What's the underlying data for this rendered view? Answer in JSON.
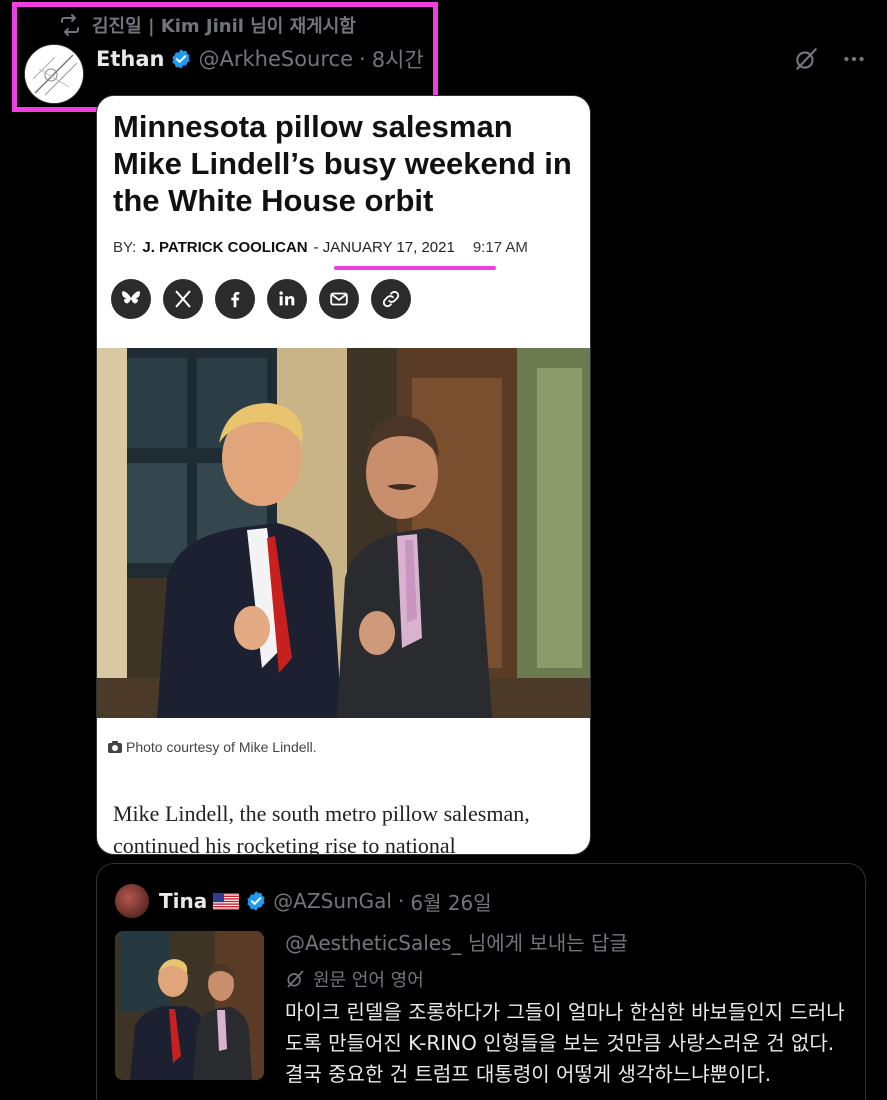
{
  "retweet": {
    "text": "김진일 | Kim Jinil 님이 재게시함"
  },
  "tweet": {
    "author_name": "Ethan",
    "handle": "@ArkheSource",
    "separator": "·",
    "time": "8시간"
  },
  "article": {
    "headline": "Minnesota pillow salesman Mike Lindell’s busy weekend in the White House orbit",
    "byline_prefix": "BY:",
    "byline_author": "J. PATRICK COOLICAN",
    "byline_date": "- JANUARY 17, 2021",
    "byline_time": "9:17 AM",
    "photo_caption": "Photo courtesy of Mike Lindell.",
    "body": "Mike Lindell, the south metro pillow salesman, continued his rocketing rise to national"
  },
  "share_icons": [
    "bluesky-icon",
    "x-icon",
    "facebook-icon",
    "linkedin-icon",
    "email-icon",
    "link-icon"
  ],
  "quote": {
    "author_name": "Tina",
    "handle": "@AZSunGal",
    "separator": "·",
    "time": "6월 26일",
    "reply_to": "@AestheticSales_ 님에게 보내는 답글",
    "translate_label": "원문 언어 영어",
    "text": "마이크 린델을 조롱하다가 그들이 얼마나 한심한 바보들인지 드러나도록 만들어진 K-RINO 인형들을 보는 것만큼 사랑스러운 건 없다. 결국 중요한 건 트럼프 대통령이 어떻게 생각하느냐뿐이다."
  },
  "colors": {
    "background": "#000000",
    "text_primary": "#e7e9ea",
    "text_secondary": "#71767b",
    "verified_blue": "#1d9bf0",
    "highlight": "#f03ee0"
  }
}
